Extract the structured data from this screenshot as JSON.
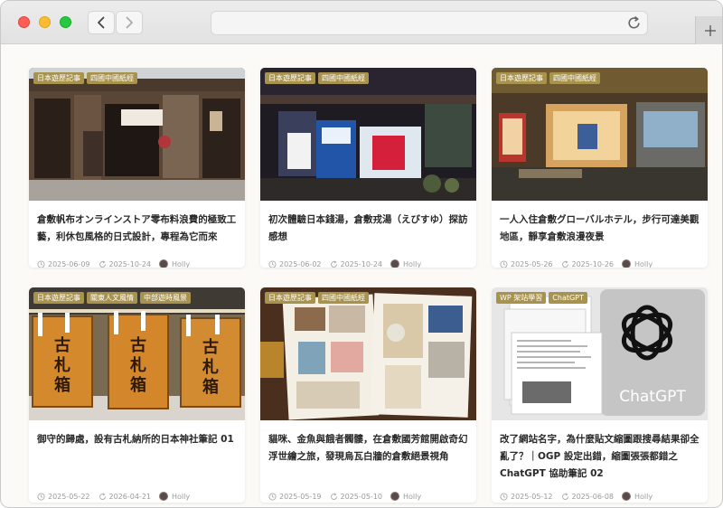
{
  "browser": {
    "address": "",
    "icons": {
      "back": "chevron-left-icon",
      "forward": "chevron-right-icon",
      "reload": "reload-icon",
      "new_tab": "plus-icon"
    }
  },
  "posts": [
    {
      "tags": [
        "日本遊歷記事",
        "四國中國紙經"
      ],
      "title": "倉敷帆布オンラインストア零布料浪費的極致工藝，利休包風格的日式設計，專程為它而來",
      "published": "2025-06-09",
      "updated": "2025-10-24",
      "author": "Holly",
      "thumbnail": "wooden-shop-front"
    },
    {
      "tags": [
        "日本遊歷記事",
        "四國中國紙經"
      ],
      "title": "初次體驗日本錢湯，倉敷戎湯（えびすゆ）探訪感想",
      "published": "2025-06-02",
      "updated": "2025-10-24",
      "author": "Holly",
      "thumbnail": "bathhouse-night"
    },
    {
      "tags": [
        "日本遊歷記事",
        "四國中國紙經"
      ],
      "title": "一人入住倉敷グローバルホテル，步行可達美觀地區，靜享倉敷浪漫夜景",
      "published": "2025-05-26",
      "updated": "2025-10-26",
      "author": "Holly",
      "thumbnail": "hotel-night"
    },
    {
      "tags": [
        "日本遊歷記事",
        "關東人文風情",
        "中部遊時風景"
      ],
      "title": "御守的歸處，設有古札納所的日本神社筆記 01",
      "published": "2025-05-22",
      "updated": "2026-04-21",
      "author": "Holly",
      "thumbnail": "shrine-boxes",
      "box_text": [
        "古札箱",
        "古札箱",
        "古札箱"
      ]
    },
    {
      "tags": [
        "日本遊歷記事",
        "四國中國紙經"
      ],
      "title": "貓咪、金魚與餓者髑髏，在倉敷國芳館開啟奇幻浮世繪之旅，發現烏瓦白牆的倉敷絕景視角",
      "published": "2025-05-19",
      "updated": "2025-05-10",
      "author": "Holly",
      "thumbnail": "travel-journal"
    },
    {
      "tags": [
        "WP 架站學習",
        "ChatGPT"
      ],
      "title": "改了網站名字，為什麼貼文縮圖跟搜尋結果卻全亂了？｜OGP 設定出錯，縮圖張張都錯之 ChatGPT 協助筆記 02",
      "published": "2025-05-12",
      "updated": "2025-06-08",
      "author": "Holly",
      "thumbnail": "chatgpt-logo",
      "logo_text": "ChatGPT"
    }
  ],
  "colors": {
    "tag": "#a8934e",
    "page_bg": "#fbfaf6",
    "title": "#2a2a2a",
    "meta": "#9a9a9a"
  }
}
